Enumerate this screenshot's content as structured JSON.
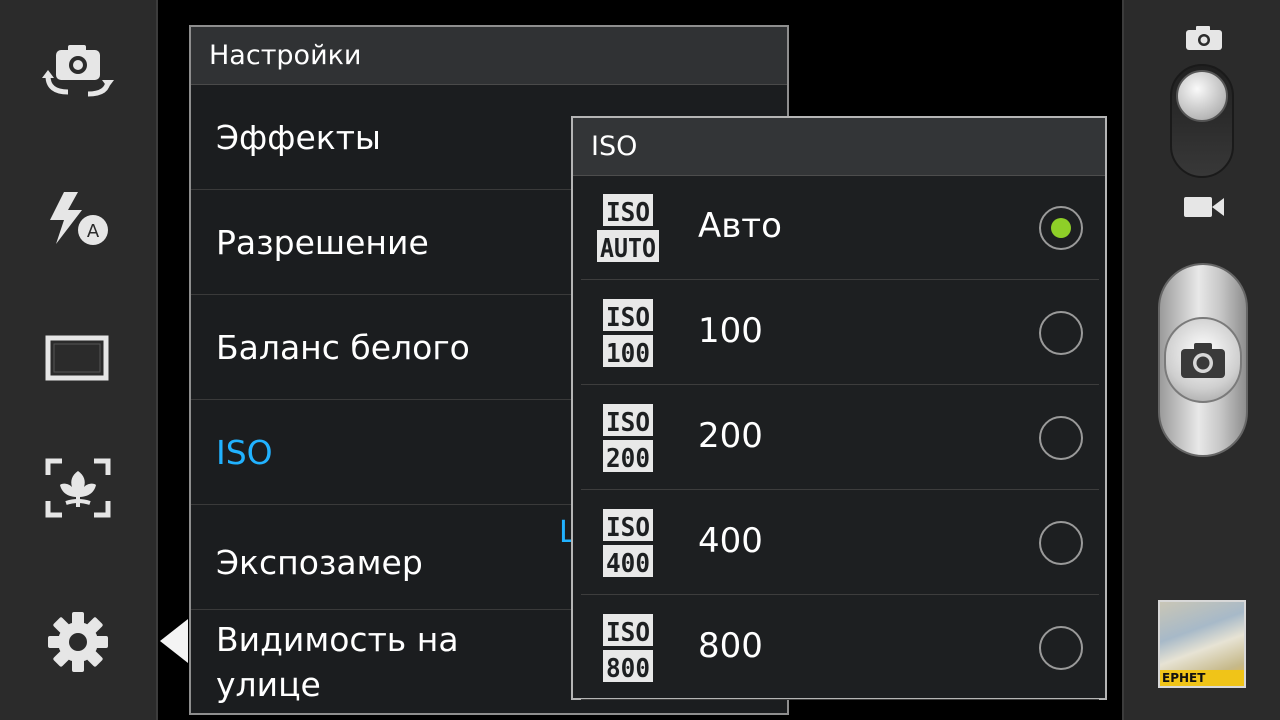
{
  "settings": {
    "title": "Настройки",
    "items": [
      {
        "label": "Эффекты"
      },
      {
        "label": "Разрешение"
      },
      {
        "label": "Баланс белого"
      },
      {
        "label": "ISO"
      },
      {
        "label": "Экспозамер",
        "value_fragment": "L"
      },
      {
        "label": "Видимость на улице"
      }
    ],
    "active_index": 3
  },
  "iso_popup": {
    "title": "ISO",
    "options": [
      {
        "label": "Авто",
        "icon_top": "ISO",
        "icon_bottom": "AUTO",
        "selected": true
      },
      {
        "label": "100",
        "icon_top": "ISO",
        "icon_bottom": "100",
        "selected": false
      },
      {
        "label": "200",
        "icon_top": "ISO",
        "icon_bottom": "200",
        "selected": false
      },
      {
        "label": "400",
        "icon_top": "ISO",
        "icon_bottom": "400",
        "selected": false
      },
      {
        "label": "800",
        "icon_top": "ISO",
        "icon_bottom": "800",
        "selected": false
      }
    ]
  },
  "left_toolbar": {
    "icons": [
      "switch-camera-icon",
      "flash-auto-icon",
      "screen-ratio-icon",
      "focus-mode-icon",
      "settings-gear-icon"
    ]
  },
  "right_toolbar": {
    "mode_icons": [
      "photo-mode-icon",
      "video-mode-icon"
    ],
    "thumbnail_text": "ЕРНЕТ"
  },
  "colors": {
    "accent": "#21b2ff",
    "radio_selected": "#8ecf28",
    "panel_bg": "#1b1d1f",
    "bar_bg": "#2b2b2b"
  }
}
